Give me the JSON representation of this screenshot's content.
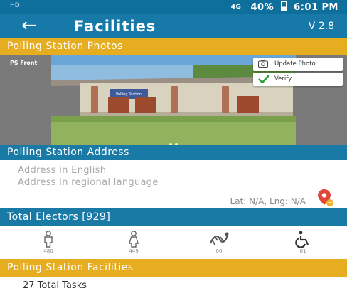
{
  "status_bar": {
    "carrier": "HD",
    "signal": "4G",
    "battery": "40%",
    "time": "6:01 PM"
  },
  "header": {
    "title": "Facilities",
    "version": "V 2.8"
  },
  "sections": {
    "photos": "Polling Station Photos",
    "address": "Polling Station Address",
    "electors": "Total Electors [929]",
    "facilities": "Polling Station Facilities"
  },
  "photo": {
    "caption": "PS Front",
    "update_label": "Update Photo",
    "verify_label": "Verify",
    "sign_text": "Polling Station"
  },
  "address": {
    "english_placeholder": "Address in English",
    "regional_placeholder": "Address in regional language",
    "latlng": "Lat: N/A, Lng: N/A"
  },
  "electors": [
    {
      "icon": "male-icon",
      "count": "480"
    },
    {
      "icon": "female-icon",
      "count": "449"
    },
    {
      "icon": "third-gender-icon",
      "count": "00"
    },
    {
      "icon": "wheelchair-icon",
      "count": "01"
    }
  ],
  "facilities": {
    "total_tasks": "27 Total Tasks"
  },
  "colors": {
    "primary": "#1779a8",
    "accent": "#e5ad1f",
    "verify": "#2e9d3a",
    "pin": "#e0463a"
  }
}
